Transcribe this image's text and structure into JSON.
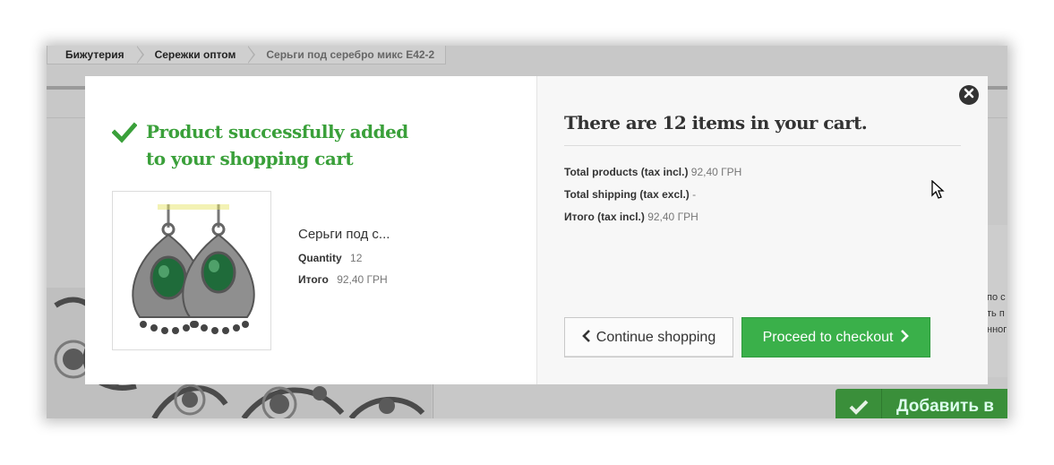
{
  "breadcrumb": {
    "items": [
      "Бижутерия",
      "Сережки оптом",
      "Серьги под серебро микс Е42-2"
    ]
  },
  "background": {
    "right_text": [
      "по с",
      "ть п",
      "нног"
    ],
    "add_to_cart_label": "Добавить в"
  },
  "modal": {
    "left": {
      "success_message": "Product successfully added to your shopping cart",
      "product_name": "Серьги под с...",
      "quantity_label": "Quantity",
      "quantity_value": "12",
      "total_label": "Итого",
      "total_value": "92,40 ГРН"
    },
    "right": {
      "title": "There are 12 items in your cart.",
      "totals": [
        {
          "label": "Total products (tax incl.)",
          "value": "92,40 ГРН"
        },
        {
          "label": "Total shipping (tax excl.)",
          "value": "-"
        },
        {
          "label": "Итого (tax incl.)",
          "value": "92,40 ГРН"
        }
      ],
      "continue_label": "Continue shopping",
      "checkout_label": "Proceed to checkout"
    }
  },
  "icons": {
    "success": "check-icon",
    "close": "close-icon",
    "continue": "chevron-left-icon",
    "checkout": "chevron-right-icon",
    "cursor": "mouse-cursor-icon"
  },
  "colors": {
    "success_green": "#3aa03a",
    "checkout_green": "#3ab04a",
    "overlay": "#c8c8c8"
  }
}
